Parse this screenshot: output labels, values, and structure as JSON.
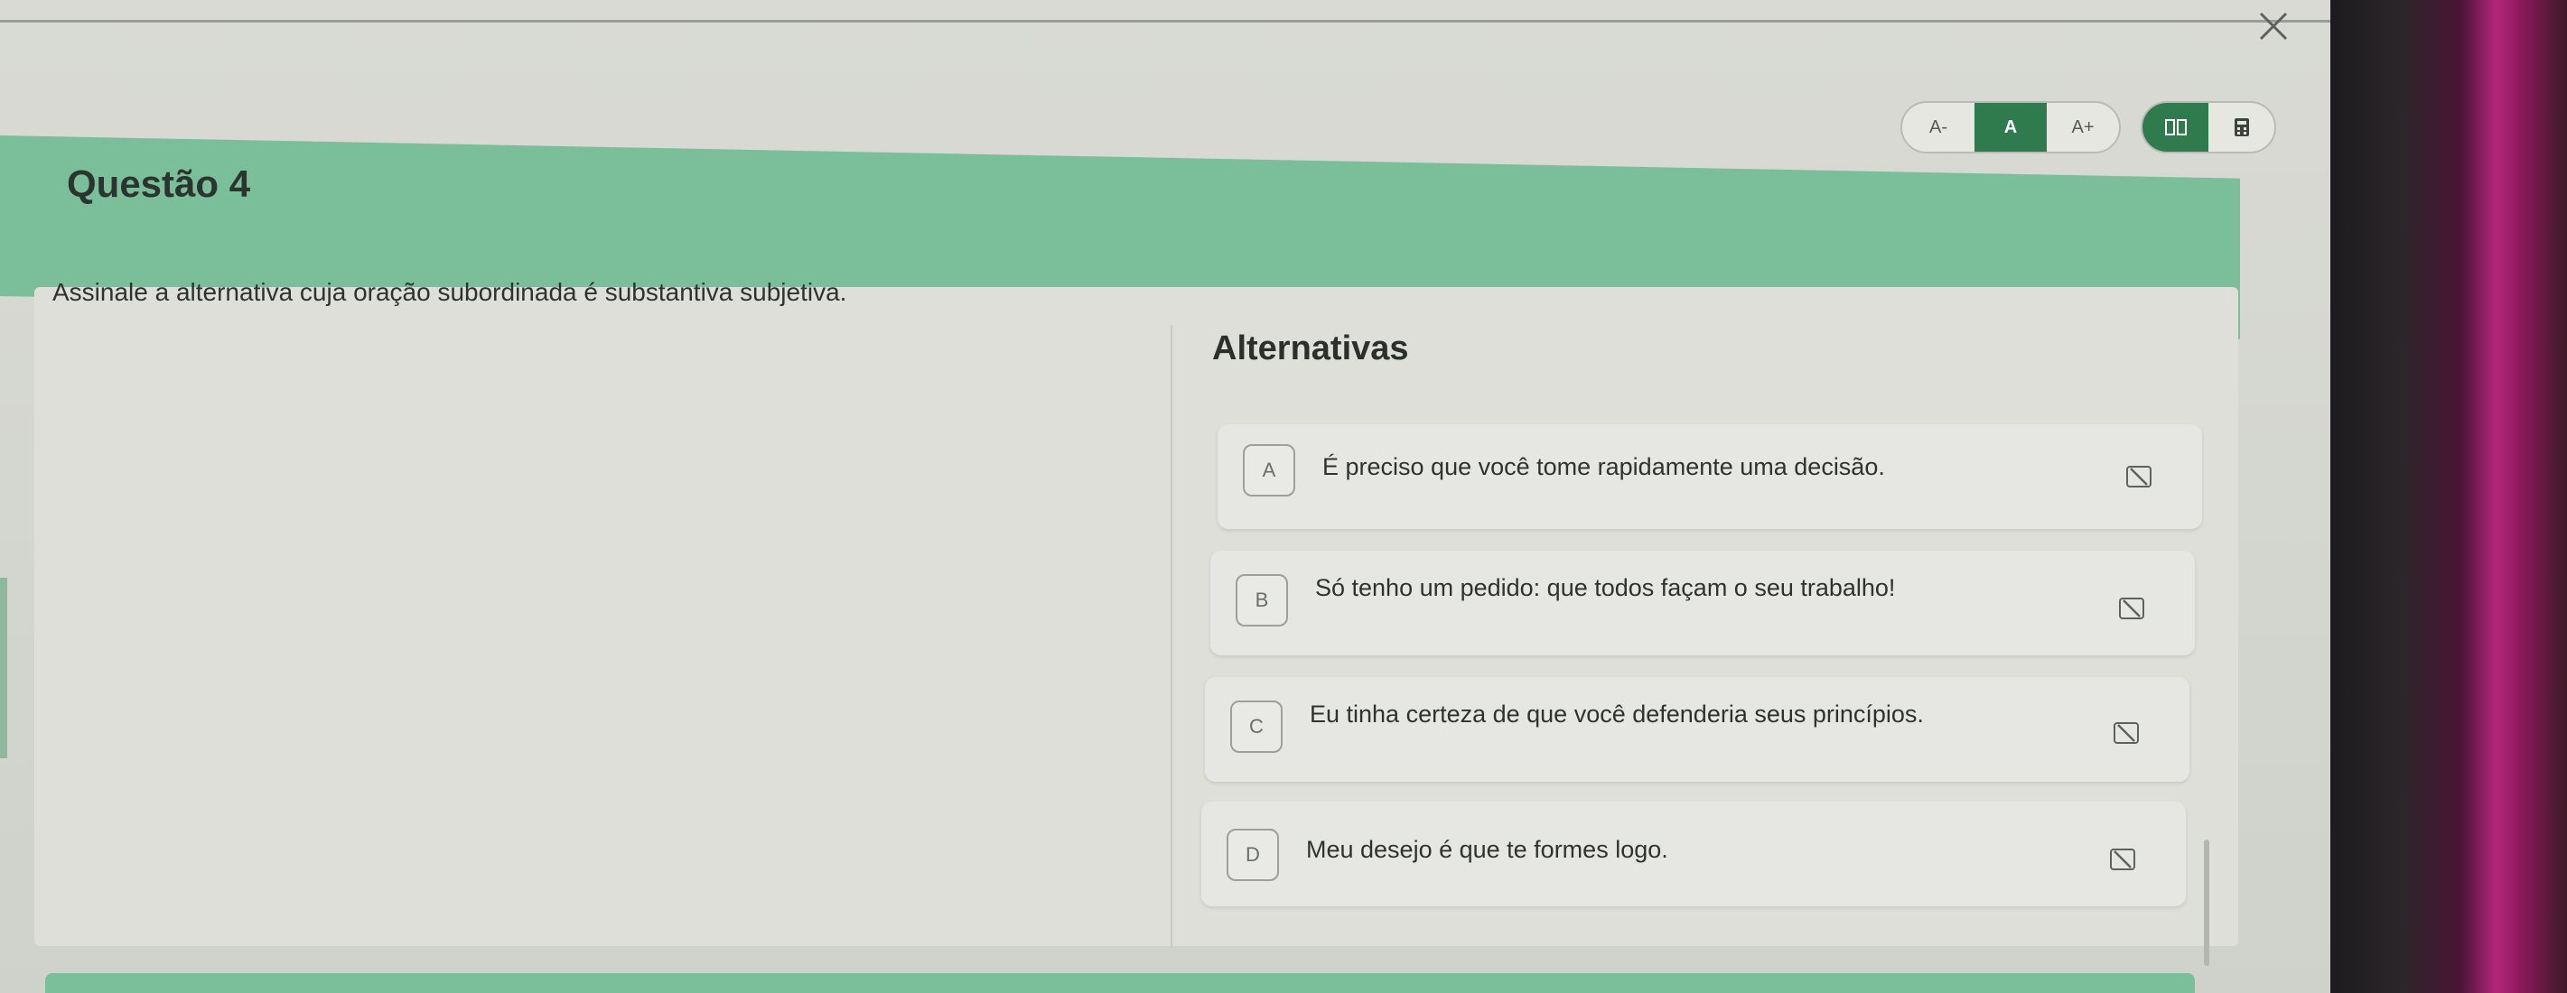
{
  "toolbar": {
    "font_decrease": "A-",
    "font_default": "A",
    "font_increase": "A+"
  },
  "question": {
    "title": "Questão 4",
    "statement": "Assinale a alternativa cuja oração subordinada é substantiva subjetiva."
  },
  "alternatives": {
    "title": "Alternativas",
    "items": [
      {
        "letter": "A",
        "text": "É preciso que você tome rapidamente uma decisão."
      },
      {
        "letter": "B",
        "text": "Só tenho um pedido: que todos façam o seu trabalho!"
      },
      {
        "letter": "C",
        "text": "Eu tinha certeza de que você defenderia seus princípios."
      },
      {
        "letter": "D",
        "text": "Meu desejo é que te formes logo."
      }
    ]
  },
  "colors": {
    "accent": "#2f7b4d",
    "header": "#7bbf9a",
    "panel": "#dedfd9"
  },
  "icons": {
    "close": "close-icon",
    "columns": "columns-icon",
    "calculator": "calculator-icon",
    "strike": "strikethrough-icon"
  }
}
